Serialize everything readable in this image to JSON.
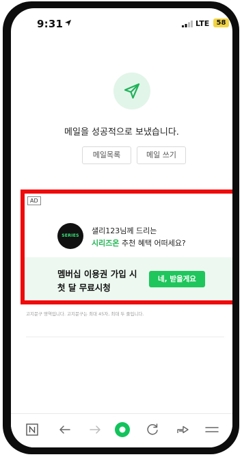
{
  "status_bar": {
    "time": "9:31",
    "network": "LTE",
    "battery": "58"
  },
  "success": {
    "message": "메일을 성공적으로 보냈습니다."
  },
  "buttons": {
    "mail_list": "메일목록",
    "write_mail": "메일 쓰기"
  },
  "ad": {
    "tag": "AD",
    "logo_text": "SERIES",
    "line1": "샐리123님께 드리는",
    "line2_highlight": "시리즈온",
    "line2_rest": " 추천 혜택 어떠세요?",
    "promo_line1": "멤버십 이용권 가입 시",
    "promo_line2": "첫 달 무료시청",
    "cta": "네, 받을게요"
  },
  "notice": "고지문구 영역입니다. 고지문구는 최대 45자, 최대 두 줄입니다.",
  "colors": {
    "accent_green": "#1ec65c",
    "highlight_border": "#ef0b0b",
    "battery": "#f2d544"
  },
  "toolbar": {
    "icons": [
      "naver-n-icon",
      "back-arrow-icon",
      "forward-arrow-icon",
      "home-dot-icon",
      "reload-icon",
      "share-icon",
      "menu-icon"
    ]
  }
}
